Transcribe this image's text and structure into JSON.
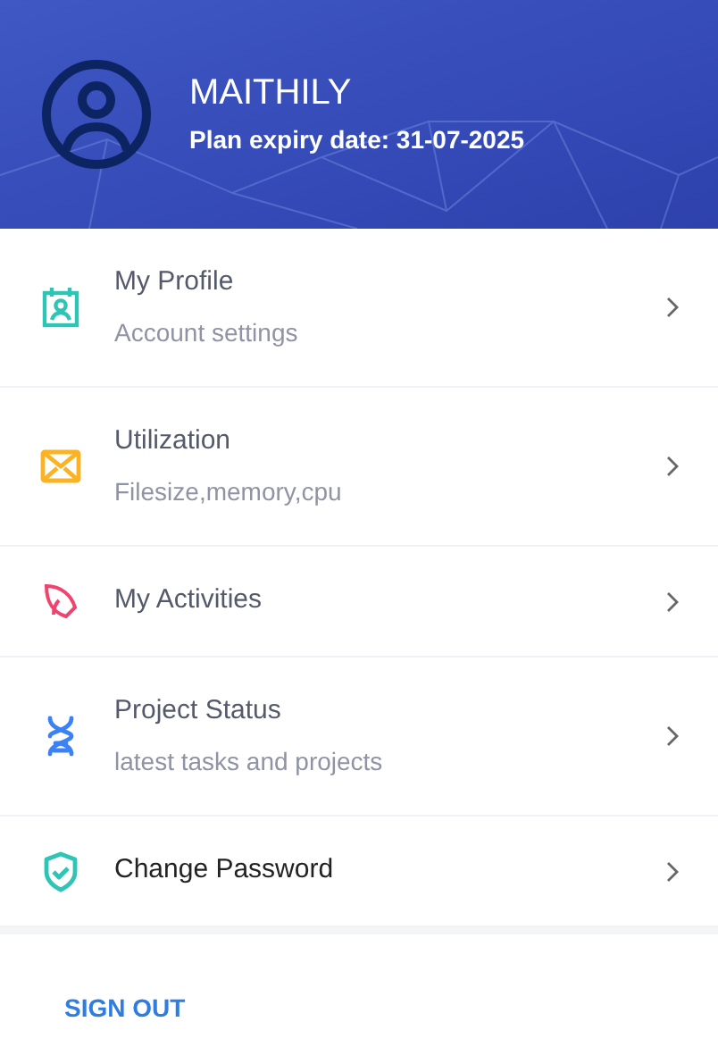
{
  "header": {
    "name": "MAITHILY",
    "plan_expiry": "Plan expiry date: 31-07-2025"
  },
  "menu": [
    {
      "kind": "profile",
      "title": "My Profile",
      "subtitle": "Account settings"
    },
    {
      "kind": "utilization",
      "title": "Utilization",
      "subtitle": "Filesize,memory,cpu"
    },
    {
      "kind": "activities",
      "title": "My Activities"
    },
    {
      "kind": "status",
      "title": "Project Status",
      "subtitle": "latest tasks and projects"
    },
    {
      "kind": "password",
      "title": "Change Password"
    }
  ],
  "sign_out": "SIGN OUT"
}
